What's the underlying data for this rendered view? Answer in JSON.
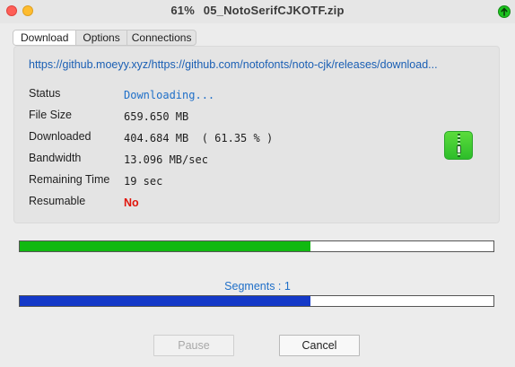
{
  "window": {
    "title_percent": "61%",
    "title_file": "05_NotoSerifCJKOTF.zip"
  },
  "tabs": [
    {
      "label": "Download",
      "active": true
    },
    {
      "label": "Options",
      "active": false
    },
    {
      "label": "Connections",
      "active": false
    }
  ],
  "download": {
    "url": "https://github.moeyy.xyz/https://github.com/notofonts/noto-cjk/releases/download...",
    "fields": [
      {
        "label": "Status",
        "value": "Downloading..."
      },
      {
        "label": "File Size",
        "value": "659.650 MB"
      },
      {
        "label": "Downloaded",
        "value": "404.684 MB  ( 61.35 % )"
      },
      {
        "label": "Bandwidth",
        "value": "13.096 MB/sec"
      },
      {
        "label": "Remaining Time",
        "value": "19 sec"
      },
      {
        "label": "Resumable",
        "value": "No"
      }
    ]
  },
  "progress": {
    "overall_fraction": 0.6135,
    "segment_fraction": 0.6135,
    "segments_label": "Segments : 1"
  },
  "buttons": {
    "pause": "Pause",
    "cancel": "Cancel"
  },
  "icons": {
    "status": "download-arrow-icon",
    "file": "zip-archive-icon"
  },
  "colors": {
    "status_text": "#1f6fc8",
    "resumable_no": "#e0160c",
    "overall_bar": "#11b911",
    "segment_bar": "#1439c8"
  }
}
